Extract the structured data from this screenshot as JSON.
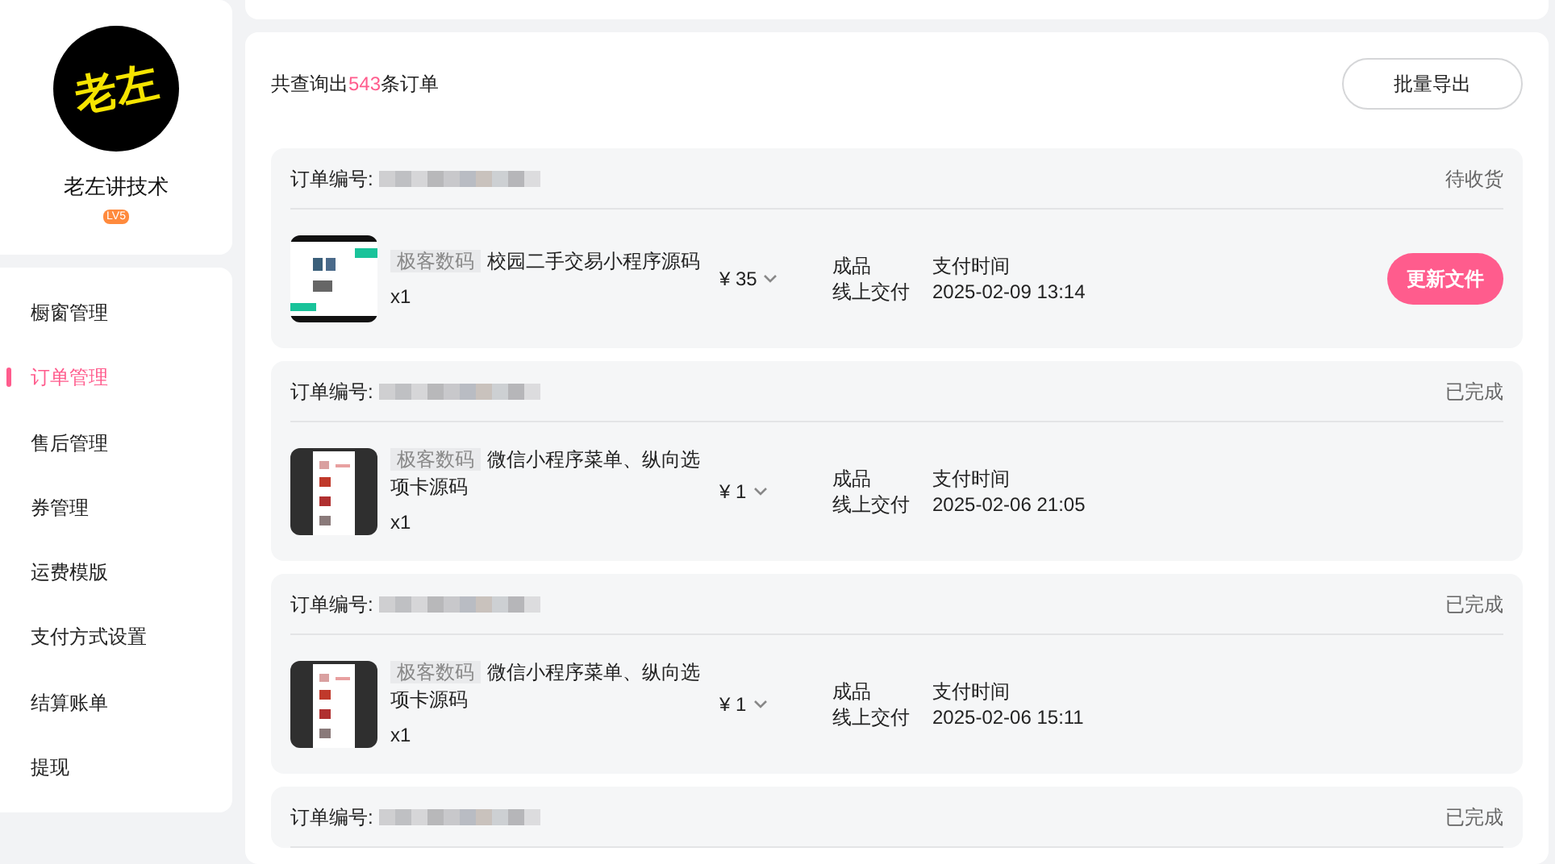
{
  "profile": {
    "avatar_text": "老左",
    "name": "老左讲技术",
    "level_badge": "LV5"
  },
  "menu": [
    {
      "label": "橱窗管理",
      "selected": false
    },
    {
      "label": "订单管理",
      "selected": true
    },
    {
      "label": "售后管理",
      "selected": false
    },
    {
      "label": "券管理",
      "selected": false
    },
    {
      "label": "运费模版",
      "selected": false
    },
    {
      "label": "支付方式设置",
      "selected": false
    },
    {
      "label": "结算账单",
      "selected": false
    },
    {
      "label": "提现",
      "selected": false
    }
  ],
  "summary": {
    "prefix": "共查询出",
    "count": "543",
    "suffix": "条订单"
  },
  "export_button": "批量导出",
  "orders": [
    {
      "number_label": "订单编号:",
      "status": "待收货",
      "shop": "极客数码",
      "title": "校园二手交易小程序源码",
      "quantity": "x1",
      "price": "¥ 35",
      "type": "成品",
      "delivery": "线上交付",
      "time_label": "支付时间",
      "time": "2025-02-09 13:14",
      "action": "更新文件",
      "kind": "light"
    },
    {
      "number_label": "订单编号:",
      "status": "已完成",
      "shop": "极客数码",
      "title": "微信小程序菜单、纵向选项卡源码",
      "quantity": "x1",
      "price": "¥ 1",
      "type": "成品",
      "delivery": "线上交付",
      "time_label": "支付时间",
      "time": "2025-02-06 21:05",
      "kind": "dark"
    },
    {
      "number_label": "订单编号:",
      "status": "已完成",
      "shop": "极客数码",
      "title": "微信小程序菜单、纵向选项卡源码",
      "quantity": "x1",
      "price": "¥ 1",
      "type": "成品",
      "delivery": "线上交付",
      "time_label": "支付时间",
      "time": "2025-02-06 15:11",
      "kind": "dark"
    },
    {
      "number_label": "订单编号:",
      "status": "已完成"
    }
  ]
}
